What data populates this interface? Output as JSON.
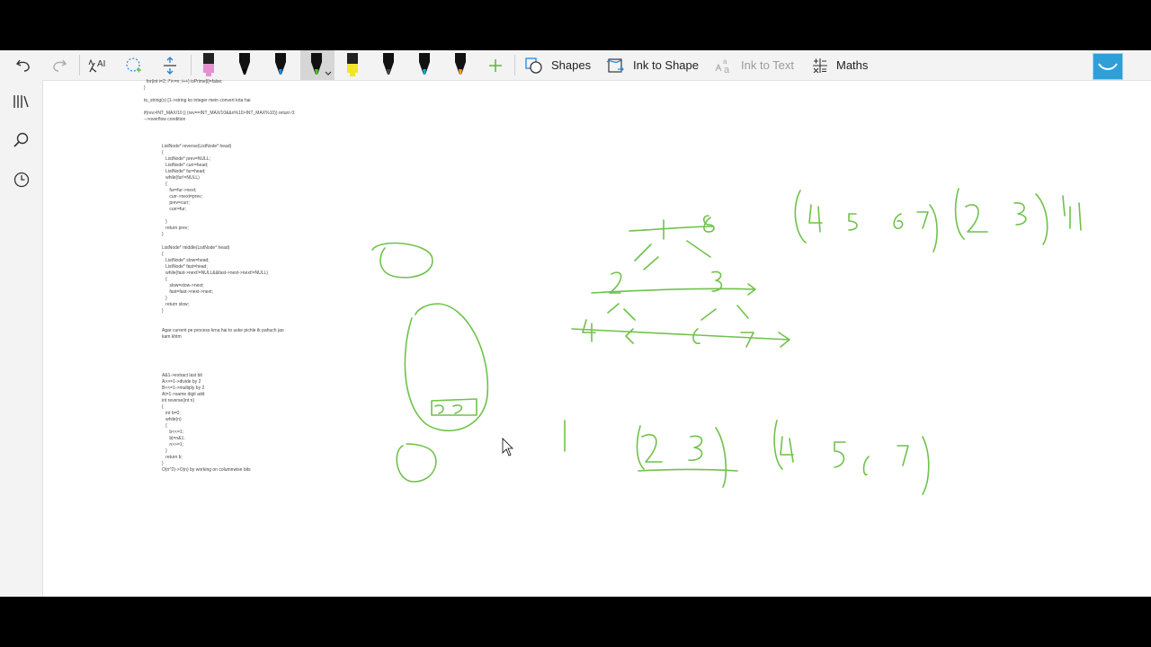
{
  "toolbar": {
    "undo_icon": "undo-icon",
    "redo_icon": "redo-icon",
    "shapes_label": "Shapes",
    "ink_to_shape_label": "Ink to Shape",
    "ink_to_text_label": "Ink to Text",
    "maths_label": "Maths",
    "pens": [
      {
        "name": "pink-highlighter",
        "color": "#e78fd0"
      },
      {
        "name": "black-pen",
        "color": "#000000"
      },
      {
        "name": "blue-pen",
        "color": "#2b86d6"
      },
      {
        "name": "green-pen",
        "color": "#4cbf2a"
      },
      {
        "name": "yellow-highlighter",
        "color": "#f1e52b"
      },
      {
        "name": "galaxy-pen",
        "color": "#444444"
      },
      {
        "name": "teal-pen",
        "color": "#1aa6c4"
      },
      {
        "name": "orange-pen",
        "color": "#f0a020"
      }
    ],
    "ink_color": "#6fc24a"
  },
  "notes": {
    "top": [
      "  for(int i=2; i*i<=n; i++) isPrime[i]=false;",
      "}",
      "",
      "to_string(x) [1->string ko integer mein convert krta hai",
      "",
      "if(rev>INT_MAX/10 || (rev==INT_MAX/10&&n%10>INT_MAX%10)) return 0;",
      "-->overflow condition"
    ],
    "reverse": [
      "ListNode* reverse(ListNode* head)",
      "{",
      "   ListNode* prev=NULL;",
      "   ListNode* curr=head;",
      "   ListNode* fur=head;",
      "   while(fur!=NULL)",
      "   {",
      "      fur=fur->next;",
      "      curr->next=prev;",
      "      prev=curr;",
      "      curr=fur;",
      "",
      "   }",
      "   return prev;",
      "}"
    ],
    "middle": [
      "ListNode* middle(ListNode* head)",
      "{",
      "   ListNode* slow=head;",
      "   ListNode* fast=head;",
      "   while(fast->next!=NULL&&fast->next->next!=NULL)",
      "   {",
      "      slow=slow->next;",
      "      fast=fast->next->next;",
      "   }",
      "   return slow;",
      "}"
    ],
    "process": [
      "Agar current pe process krna hai to uske pichle tk pahuch jao",
      "kam khtm"
    ],
    "bits": [
      "A&1->extract last bit",
      "A>>=1->divide by 2",
      "B<<=1->multiply by 2",
      "A|=1->same digit add",
      "int reverse(int n)",
      "{",
      "   int b=0;",
      "   while(n)",
      "   {",
      "      b<<=1;",
      "      b|=n&1;",
      "      n>>=1;",
      "   }",
      "   return b;",
      "}",
      "O(n^2)->O(n) by working on columnwise bits"
    ]
  }
}
